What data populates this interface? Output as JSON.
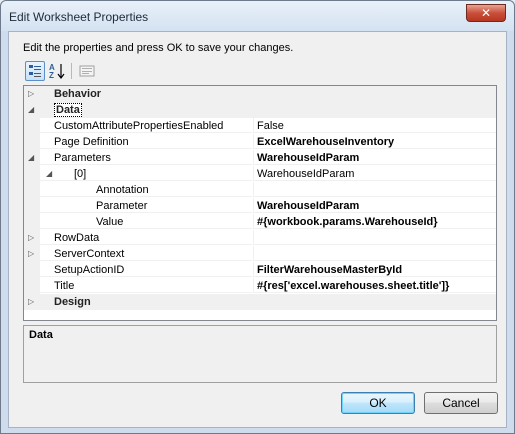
{
  "window": {
    "title": "Edit Worksheet Properties",
    "close_glyph": "✕"
  },
  "instruction": "Edit the properties and press OK to save your changes.",
  "toolbar": {
    "categorized_icon": "categorized-icon",
    "alphabetical_icon": "alphabetical-icon",
    "property_pages_icon": "property-pages-icon"
  },
  "grid": {
    "rows": [
      {
        "type": "category",
        "expander": "▷",
        "name": "Behavior"
      },
      {
        "type": "category",
        "expander": "◢",
        "name": "Data"
      },
      {
        "type": "property",
        "name": "CustomAttributePropertiesEnabled",
        "value": "False",
        "bold": false
      },
      {
        "type": "property",
        "name": "Page Definition",
        "value": "ExcelWarehouseInventory",
        "bold": true
      },
      {
        "type": "category-prop",
        "expander": "◢",
        "name": "Parameters",
        "value": "WarehouseIdParam",
        "bold": true
      },
      {
        "type": "sub-prop",
        "expander": "◢",
        "name": "[0]",
        "value": "WarehouseIdParam",
        "bold": false
      },
      {
        "type": "leaf",
        "name": "Annotation",
        "value": "",
        "bold": false
      },
      {
        "type": "leaf",
        "name": "Parameter",
        "value": "WarehouseIdParam",
        "bold": true
      },
      {
        "type": "leaf",
        "name": "Value",
        "value": "#{workbook.params.WarehouseId}",
        "bold": true
      },
      {
        "type": "category-prop",
        "expander": "▷",
        "name": "RowData",
        "value": "",
        "bold": false
      },
      {
        "type": "category-prop",
        "expander": "▷",
        "name": "ServerContext",
        "value": "",
        "bold": false
      },
      {
        "type": "property",
        "name": "SetupActionID",
        "value": "FilterWarehouseMasterById",
        "bold": true
      },
      {
        "type": "property",
        "name": "Title",
        "value": "#{res['excel.warehouses.sheet.title']}",
        "bold": true
      },
      {
        "type": "category",
        "expander": "▷",
        "name": "Design"
      }
    ]
  },
  "description": {
    "title": "Data"
  },
  "buttons": {
    "ok": "OK",
    "cancel": "Cancel"
  }
}
